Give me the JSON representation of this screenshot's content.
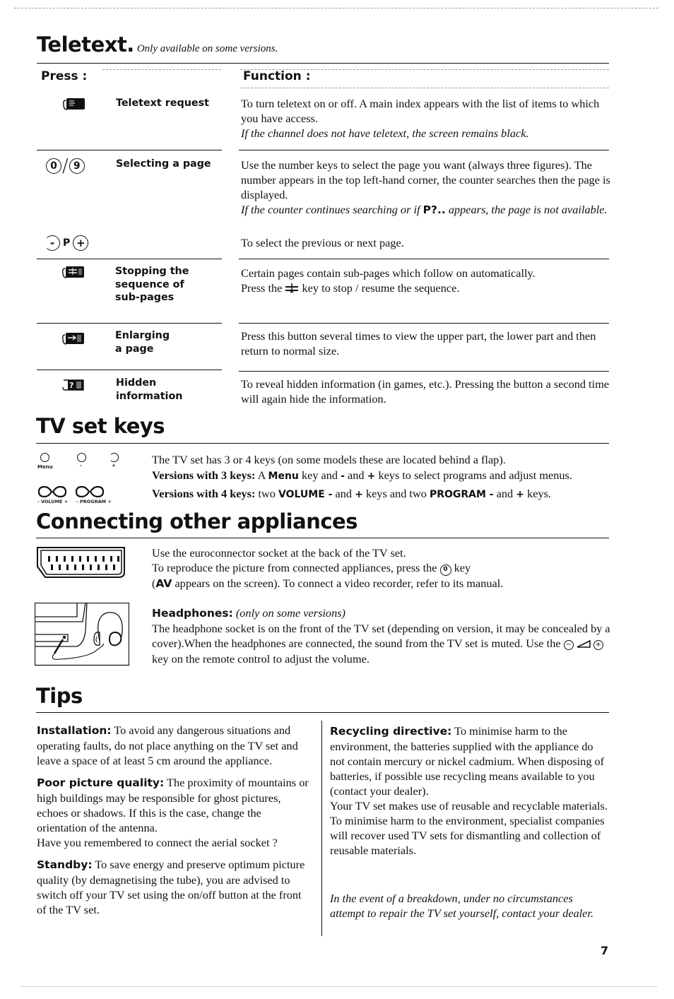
{
  "teletext": {
    "title": "Teletext.",
    "subtitle": "Only available on some versions.",
    "press_header": "Press :",
    "function_header": "Function :",
    "rows": [
      {
        "icon": "teletext-request-key-icon",
        "label": "Teletext request",
        "text": "To turn teletext on or off. A main index appears with the list of items to which you have access.",
        "note": "If the channel does not have teletext, the screen remains black."
      },
      {
        "icon": "digit-keys-0-9-icon",
        "icon_text_a": "0",
        "icon_text_sep": "/",
        "icon_text_b": "9",
        "label": "Selecting a page",
        "text": "Use the number keys to select the page you want (always three figures). The number appears in the top left-hand corner, the counter searches then the page is displayed.",
        "note_a": "If the counter continues searching or if",
        "note_kw": "P?..",
        "note_b": "appears, the page is not available."
      },
      {
        "icon": "program-minus-plus-keys-icon",
        "icon_minus": "-",
        "icon_p": "P",
        "icon_plus": "+",
        "label": "",
        "text": "To select the previous or next page."
      },
      {
        "icon": "stop-subpages-key-icon",
        "label": "Stopping the sequence of sub-pages",
        "label_lines": [
          "Stopping the",
          "sequence of",
          "sub-pages"
        ],
        "text": "Certain pages contain sub-pages which follow on automatically.",
        "text2_a": "Press the",
        "text2_icon": "hold-key-icon",
        "text2_b": "key to stop / resume the sequence."
      },
      {
        "icon": "enlarge-page-key-icon",
        "label_lines": [
          "Enlarging",
          "a page"
        ],
        "text": "Press this button several times to view the upper part, the lower part and then return to normal size."
      },
      {
        "icon": "reveal-hidden-key-icon",
        "label_lines": [
          "Hidden",
          "information"
        ],
        "text": "To reveal hidden information (in games, etc.). Pressing the button a second time will again hide the information."
      }
    ]
  },
  "tv_set_keys": {
    "title": "TV set keys",
    "key_labels_3": [
      "Menu",
      "-",
      "+"
    ],
    "key_labels_4": [
      "- VOLUME +",
      "- PROGRAM +"
    ],
    "line1": "The TV set has 3 or 4 keys (on some models these are located behind a flap).",
    "line2_lead": "Versions with 3 keys:",
    "line2_a": "A",
    "line2_kw": "Menu",
    "line2_b": "key and",
    "line2_minus": "-",
    "line2_c": "and",
    "line2_plus": "+",
    "line2_d": "keys to select programs and adjust menus.",
    "line3_lead": "Versions with 4 keys:",
    "line3_a": "two",
    "line3_kw1": "VOLUME -",
    "line3_b": "and",
    "line3_plus1": "+",
    "line3_c": "keys and two",
    "line3_kw2": "PROGRAM -",
    "line3_d": "and",
    "line3_plus2": "+",
    "line3_e": "keys."
  },
  "connecting": {
    "title": "Connecting other appliances",
    "euro_line1": "Use the euroconnector socket at the back of the TV set.",
    "euro_line2_a": "To reproduce the picture from connected appliances, press the",
    "euro_key": "0",
    "euro_line2_b": "key",
    "euro_line3_kw": "AV",
    "euro_line3_a": "(",
    "euro_line3_b": "appears on the screen). To connect a video recorder, refer to its manual.",
    "headphones_label": "Headphones:",
    "headphones_note": "(only on some versions)",
    "headphones_text_a": "The headphone socket is on the front of the TV set (depending on version, it may be concealed by a cover).When the headphones are connected, the sound from the TV set is muted. Use the",
    "headphones_minus": "−",
    "headphones_plus": "+",
    "headphones_text_b": "key on the remote control to adjust the volume."
  },
  "tips": {
    "title": "Tips",
    "left": [
      {
        "label": "Installation:",
        "text": "To avoid any dangerous situations and operating faults, do not place anything on the TV set and leave a space of at least 5 cm around the appliance."
      },
      {
        "label": "Poor picture quality:",
        "text": "The proximity of mountains or high buildings may be responsible for ghost pictures, echoes or shadows. If this is the case, change the orientation of the antenna.",
        "extra": "Have you remembered to connect the aerial socket ?"
      },
      {
        "label": "Standby:",
        "text": "To save energy and preserve optimum picture quality (by demagnetising the tube), you are advised to switch off your TV set using the on/off button at the front of the TV set."
      }
    ],
    "right": {
      "label": "Recycling directive:",
      "text": "To minimise harm to the environment, the batteries supplied with the appliance do not contain mercury or nickel cadmium. When disposing of batteries, if possible use recycling means available to you (contact your dealer).",
      "text2": "Your TV set makes use of reusable and recyclable materials. To minimise harm to the environment, specialist companies will recover used TV sets for dismantling and collection of reusable materials.",
      "warning": "In the event of a breakdown, under no circumstances attempt to repair the TV set yourself, contact your dealer."
    }
  },
  "page_number": "7"
}
